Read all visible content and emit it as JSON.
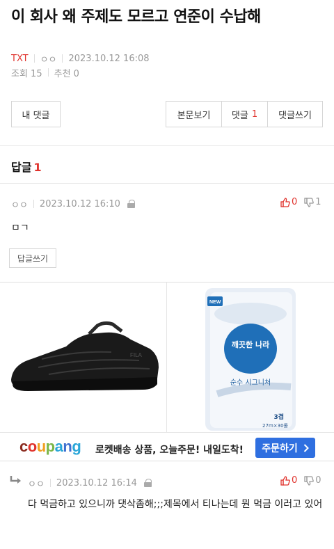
{
  "post": {
    "title": "이 회사 왜 주제도 모르고 연준이 수납해",
    "author": "TXT",
    "author_tag": "ㅇㅇ",
    "date": "2023.10.12 16:08",
    "views_label": "조회 15",
    "recommend_label": "추천 0"
  },
  "buttons": {
    "my_comments": "내 댓글",
    "view_body": "본문보기",
    "comments_label": "댓글",
    "comments_count": "1",
    "write_comment": "댓글쓰기"
  },
  "replies_section": {
    "label": "답글",
    "count": "1"
  },
  "comments": [
    {
      "author": "ㅇㅇ",
      "date": "2023.10.12 16:10",
      "up": "0",
      "down": "1",
      "text": "ㅁㄱ",
      "reply_button": "답글쓰기"
    },
    {
      "author": "ㅇㅇ",
      "date": "2023.10.12 16:14",
      "up": "0",
      "down": "0",
      "text": "다 먹금하고 있으니까 댓삭좀해;;;제목에서 티나는데 뭔 먹금 이러고 있어"
    }
  ],
  "ad": {
    "brand": "coupang",
    "text": "로켓배송 상품, 오늘주문! 내일도착!",
    "cta": "주문하기",
    "product_left_brand": "FILA",
    "product_right_name": "깨끗한 나라",
    "product_right_sub": "순수 시그니처",
    "product_right_tag": "NEW",
    "product_right_pack": "3겹",
    "product_right_count": "27m×30롤",
    "colors": {
      "accent_red": "#e0322c",
      "cta_blue": "#2f6fe0"
    }
  }
}
